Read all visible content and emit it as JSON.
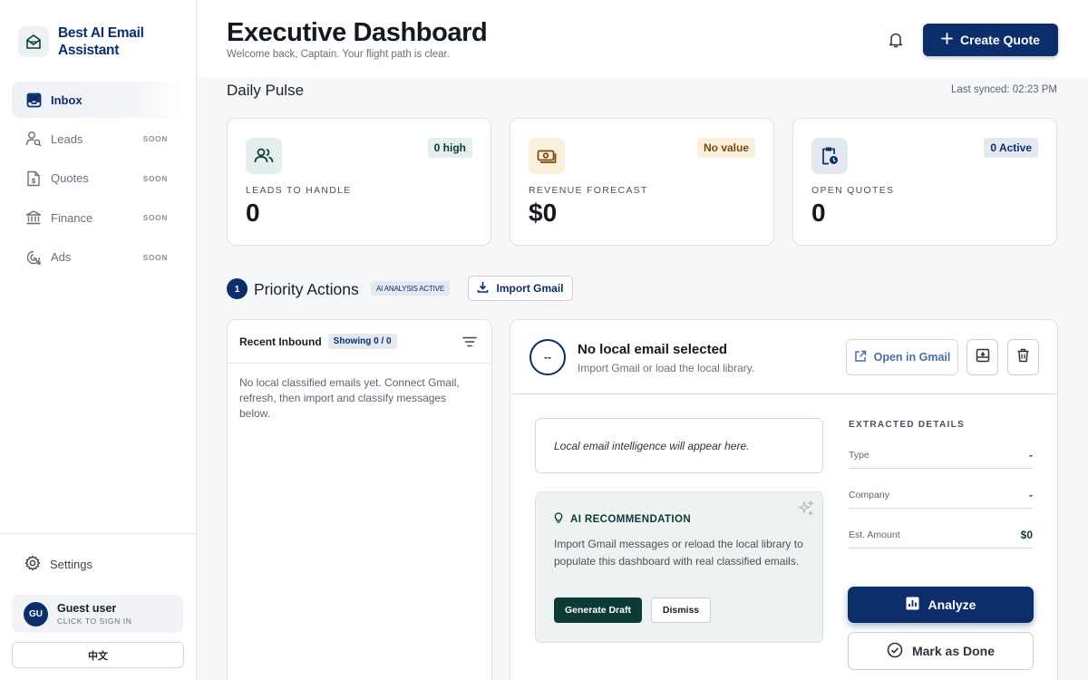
{
  "brand": {
    "name": "Best AI Email Assistant"
  },
  "sidebar": {
    "items": [
      {
        "label": "Inbox",
        "badge": "",
        "icon": "inbox-icon"
      },
      {
        "label": "Leads",
        "badge": "SOON",
        "icon": "users-search-icon"
      },
      {
        "label": "Quotes",
        "badge": "SOON",
        "icon": "dollar-file-icon"
      },
      {
        "label": "Finance",
        "badge": "SOON",
        "icon": "bank-icon"
      },
      {
        "label": "Ads",
        "badge": "SOON",
        "icon": "target-icon"
      }
    ],
    "settings_label": "Settings",
    "user": {
      "initials": "GU",
      "name": "Guest user",
      "sub": "CLICK TO SIGN IN"
    },
    "language_label": "中文"
  },
  "header": {
    "title": "Executive Dashboard",
    "subtitle": "Welcome back, Captain. Your flight path is clear.",
    "create_label": "Create Quote"
  },
  "pulse": {
    "title": "Daily Pulse",
    "last_synced": "Last synced: 02:23 PM",
    "cards": [
      {
        "label": "LEADS TO HANDLE",
        "value": "0",
        "badge": "0 high",
        "icon": "users-icon"
      },
      {
        "label": "REVENUE FORECAST",
        "value": "$0",
        "badge": "No value",
        "icon": "money-icon"
      },
      {
        "label": "OPEN QUOTES",
        "value": "0",
        "badge": "0 Active",
        "icon": "clipboard-clock-icon"
      }
    ]
  },
  "priority": {
    "number": "1",
    "title": "Priority Actions",
    "tag": "AI ANALYSIS ACTIVE",
    "import_label": "Import Gmail"
  },
  "inbound": {
    "title": "Recent Inbound",
    "showing": "Showing 0 / 0",
    "empty_text": "No local classified emails yet. Connect Gmail, refresh, then import and classify messages below."
  },
  "detail": {
    "avatar": "--",
    "title": "No local email selected",
    "subtitle": "Import Gmail or load the local library.",
    "open_gmail_label": "Open in Gmail",
    "intel_text": "Local email intelligence will appear here.",
    "ai": {
      "title": "AI RECOMMENDATION",
      "text": "Import Gmail messages or reload the local library to populate this dashboard with real classified emails.",
      "generate_label": "Generate Draft",
      "dismiss_label": "Dismiss"
    },
    "extracted": {
      "title": "EXTRACTED DETAILS",
      "rows": [
        {
          "key": "Type",
          "value": "-"
        },
        {
          "key": "Company",
          "value": "-"
        },
        {
          "key": "Est. Amount",
          "value": "$0"
        }
      ]
    },
    "analyze_label": "Analyze",
    "done_label": "Mark as Done"
  },
  "colors": {
    "primary": "#0c2e6b",
    "accent_green": "#0c3b36",
    "leads_badge_bg": "#e4eeec",
    "revenue_badge_bg": "#fbf0dc",
    "quotes_badge_bg": "#e4e9f1"
  }
}
